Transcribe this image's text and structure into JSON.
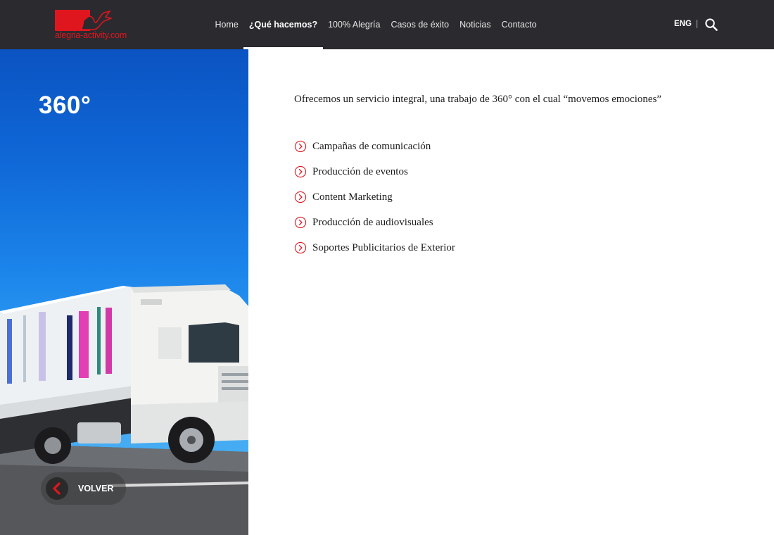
{
  "header": {
    "logo_text": "alegria-activity.com",
    "nav": [
      {
        "label": "Home",
        "active": false
      },
      {
        "label": "¿Qué hacemos?",
        "active": true
      },
      {
        "label": "100% Alegría",
        "active": false
      },
      {
        "label": "Casos de éxito",
        "active": false
      },
      {
        "label": "Noticias",
        "active": false
      },
      {
        "label": "Contacto",
        "active": false
      }
    ],
    "language": "ENG",
    "search_icon": "search-icon"
  },
  "hero": {
    "title": "360°",
    "back_label": "VOLVER",
    "back_icon": "chevron-left-icon"
  },
  "content": {
    "intro": "Ofrecemos un servicio integral, una trabajo de 360° con el cual “movemos emociones”",
    "services": [
      "Campañas de comunicación",
      "Producción de eventos",
      "Content Marketing",
      "Producción de audiovisuales",
      "Soportes Publicitarios de Exterior"
    ],
    "service_icon": "circle-chevron-right-icon"
  },
  "colors": {
    "header_bg": "#2b2a2e",
    "brand_red": "#e0161f",
    "sky_blue": "#1b84ea"
  }
}
